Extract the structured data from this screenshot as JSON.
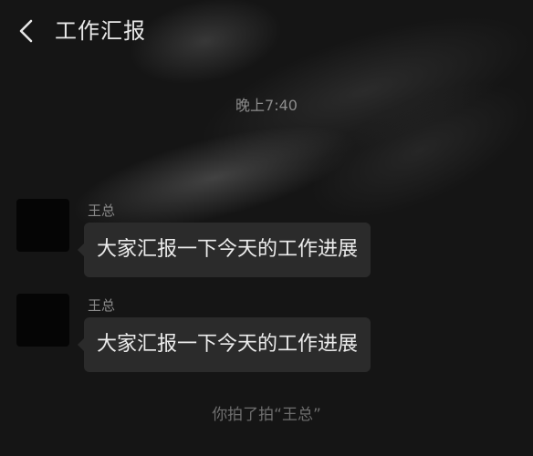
{
  "header": {
    "title": "工作汇报"
  },
  "chat": {
    "timestamp": "晚上7:40",
    "messages": [
      {
        "sender": "王总",
        "text": "大家汇报一下今天的工作进展"
      },
      {
        "sender": "王总",
        "text": "大家汇报一下今天的工作进展"
      }
    ],
    "system_note": "你拍了拍“王总”"
  },
  "colors": {
    "background": "#151515",
    "bubble": "#2b2b2b",
    "text_primary": "#ececec",
    "text_secondary": "#8a8a8a"
  },
  "icons": {
    "back": "chevron-left-icon"
  }
}
